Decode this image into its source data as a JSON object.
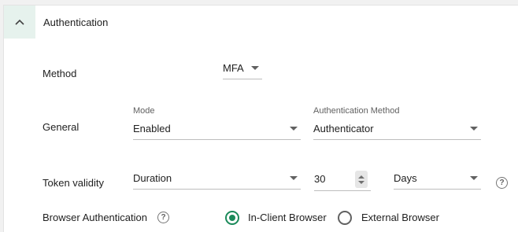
{
  "section": {
    "title": "Authentication"
  },
  "method": {
    "label": "Method",
    "value": "MFA"
  },
  "general": {
    "label": "General",
    "mode_label": "Mode",
    "mode_value": "Enabled",
    "auth_method_label": "Authentication Method",
    "auth_method_value": "Authenticator"
  },
  "token_validity": {
    "label": "Token validity",
    "type_value": "Duration",
    "amount": "30",
    "unit_value": "Days"
  },
  "browser_auth": {
    "label": "Browser Authentication",
    "options": [
      {
        "label": "In-Client Browser",
        "selected": true
      },
      {
        "label": "External Browser",
        "selected": false
      }
    ]
  },
  "help_glyph": "?",
  "colors": {
    "accent": "#1b8a5a",
    "header_button_bg": "#e6f2ed"
  },
  "icons": {
    "collapse": "chevron-up-icon",
    "help": "help-circle-icon",
    "dropdown": "caret-down-icon"
  }
}
